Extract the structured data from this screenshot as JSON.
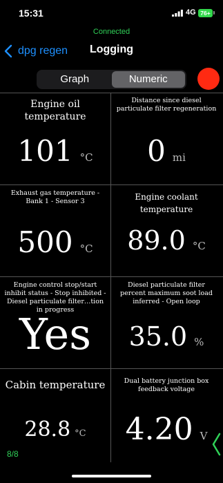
{
  "status_bar": {
    "time": "15:31",
    "network": "4G",
    "battery": "76+"
  },
  "connection_status": "Connected",
  "nav": {
    "back_label": "dpg regen",
    "title": "Logging"
  },
  "view_toggle": {
    "options": [
      "Graph",
      "Numeric"
    ],
    "selected": "Numeric"
  },
  "cells": [
    {
      "label": "Engine oil temperature",
      "value": "101",
      "unit": "°C"
    },
    {
      "label": "Distance since diesel particulate filter regeneration",
      "value": "0",
      "unit": "mi"
    },
    {
      "label": "Exhaust gas temperature  -  Bank 1  -  Sensor 3",
      "value": "500",
      "unit": "°C"
    },
    {
      "label": "Engine coolant temperature",
      "value": "89.0",
      "unit": "°C"
    },
    {
      "label": "Engine control stop/start inhibit status  -  Stop inhibited  -  Diesel particulate filter…tion in progress",
      "value": "Yes",
      "unit": ""
    },
    {
      "label": "Diesel particulate filter percent maximum soot load inferred  -  Open loop",
      "value": "35.0",
      "unit": "%"
    },
    {
      "label": "Cabin temperature",
      "value": "28.8",
      "unit": "°C"
    },
    {
      "label": "Dual battery junction box feedback voltage",
      "value": "4.20",
      "unit": "V"
    }
  ],
  "pager": "8/8",
  "colors": {
    "accent_blue": "#1e90ff",
    "connected_green": "#30d158",
    "record_red": "#ff2a12"
  },
  "icons": [
    "signal-icon",
    "battery-icon",
    "back-chevron-icon",
    "record-button",
    "chevron-left-icon"
  ]
}
